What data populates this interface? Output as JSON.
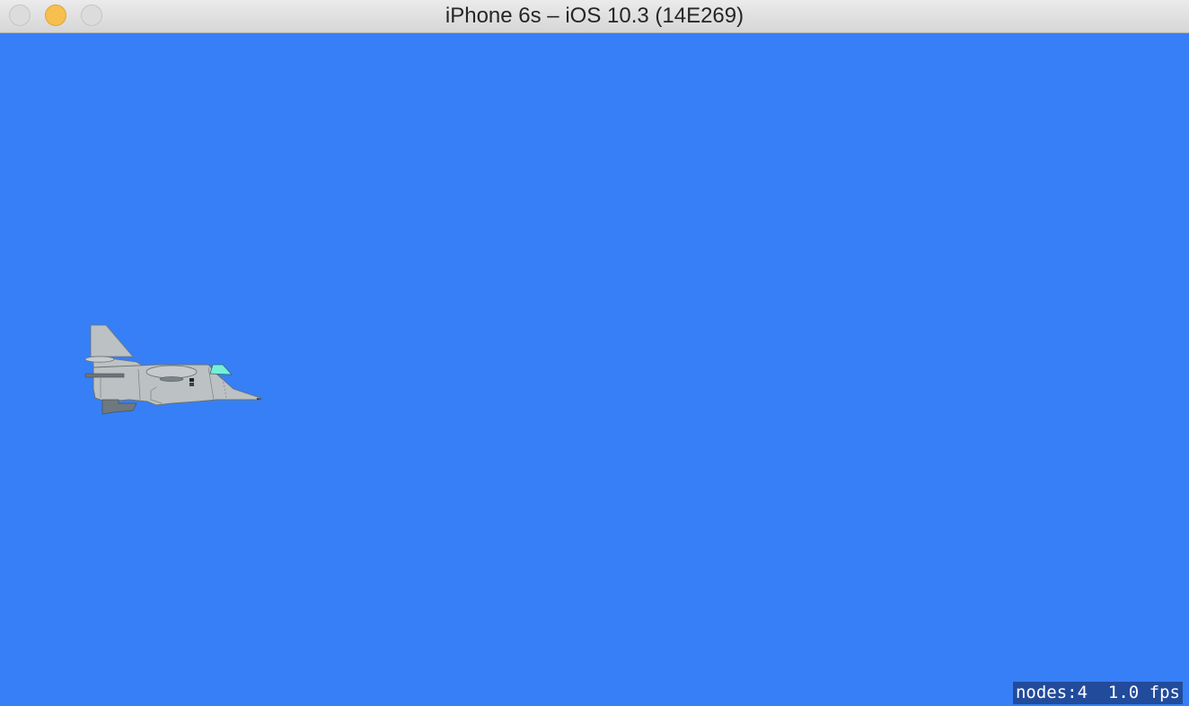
{
  "window": {
    "title": "iPhone 6s – iOS 10.3 (14E269)"
  },
  "scene": {
    "background_color": "#367ff6",
    "sprite_name": "fighter-jet"
  },
  "stats": {
    "text": "nodes:4  1.0 fps"
  }
}
